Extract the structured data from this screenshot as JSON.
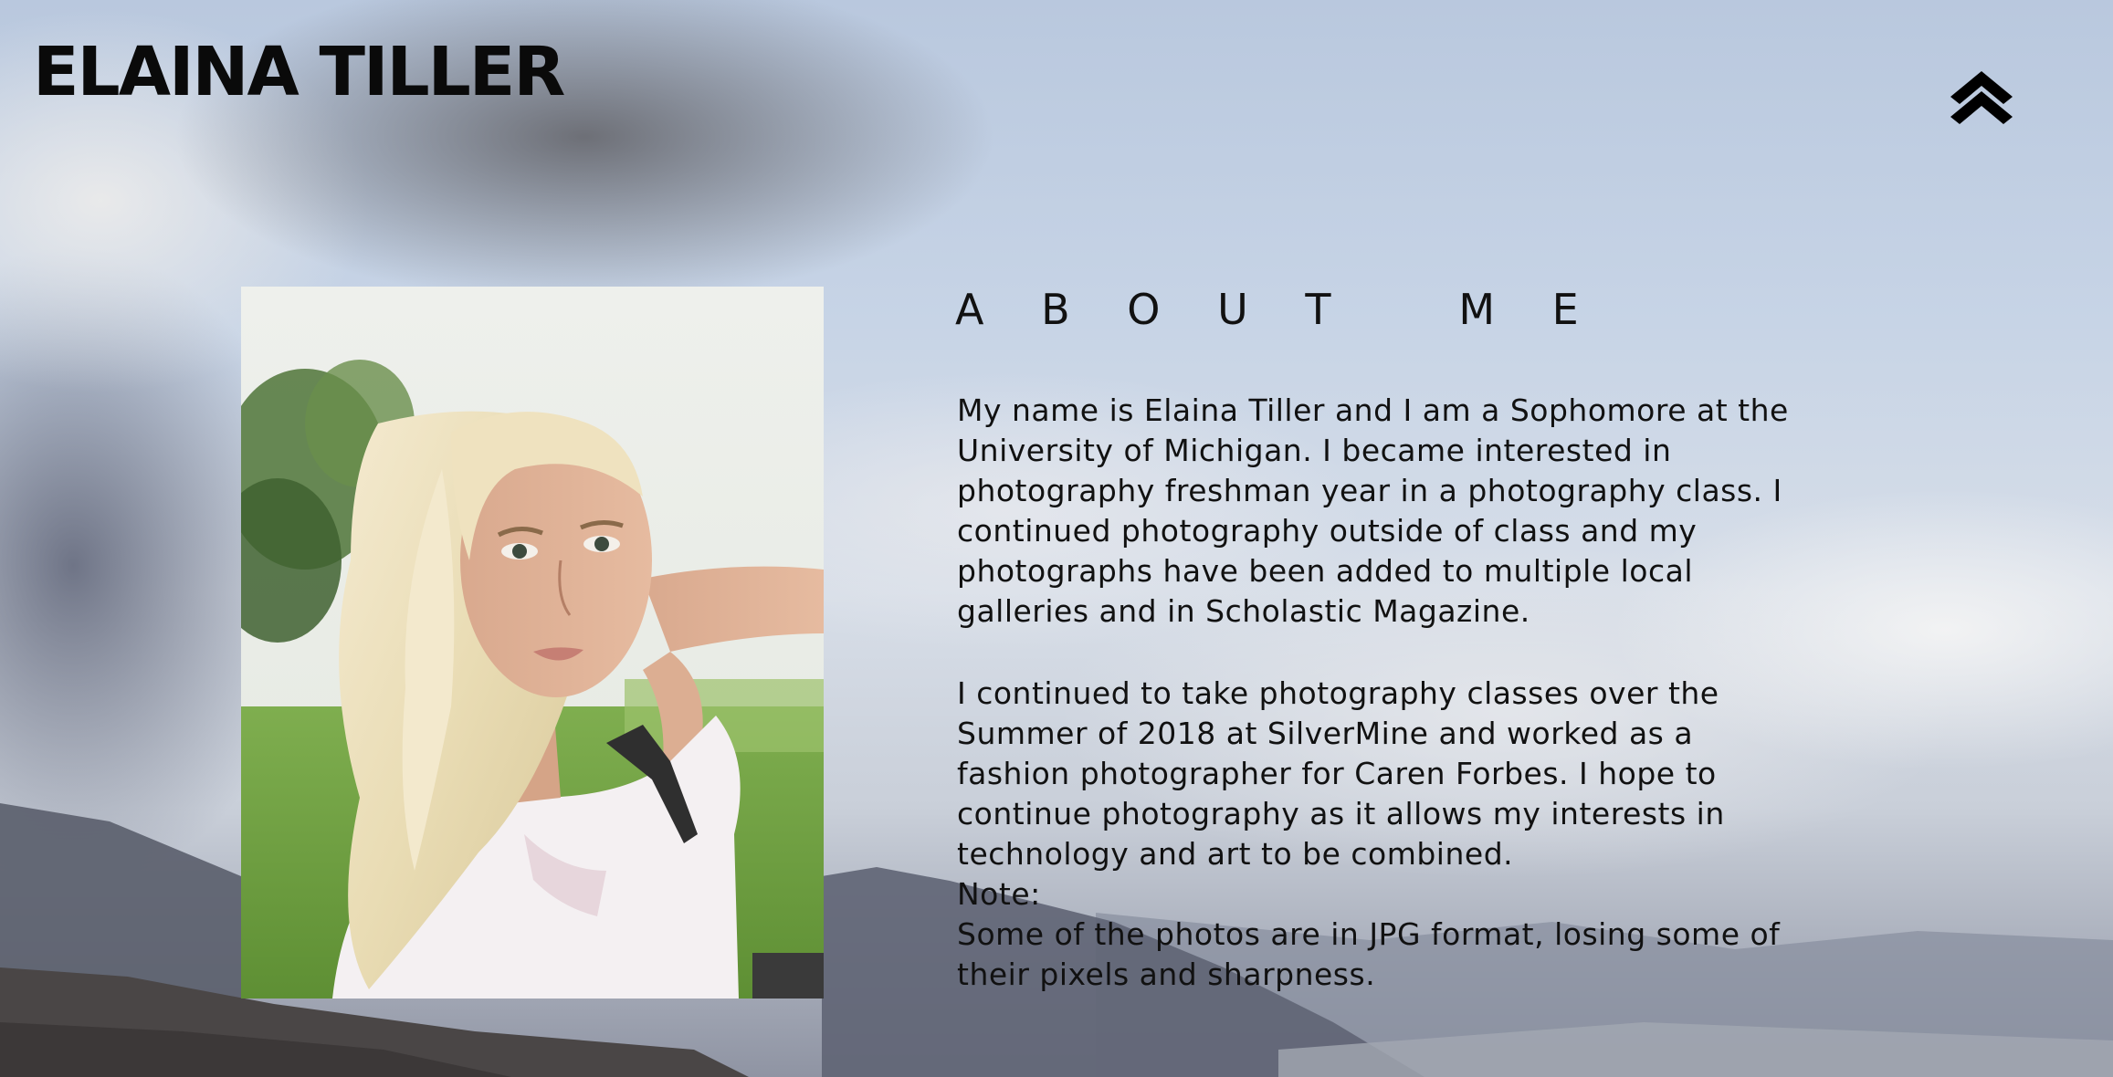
{
  "header": {
    "site_title": "ELAINA TILLER",
    "up_icon": "double-chevron-up-icon"
  },
  "about": {
    "heading": "A B O U T   M E",
    "paragraph_1": "My name is Elaina Tiller and I am a Sophomore at the University of Michigan. I became interested in photography freshman year in a photography class. I continued photography outside of class and my photographs have been added to multiple local galleries and in Scholastic Magazine.",
    "paragraph_2": "I continued to take photography classes over the Summer of 2018 at SilverMine and worked as a fashion photographer for Caren Forbes. I hope to continue photography as it allows my interests in technology and art to be combined.",
    "note_label": "Note:",
    "note_text": "Some of the photos are in JPG format, losing some of their pixels and sharpness."
  },
  "colors": {
    "text": "#111111",
    "title": "#0a0a0a"
  }
}
